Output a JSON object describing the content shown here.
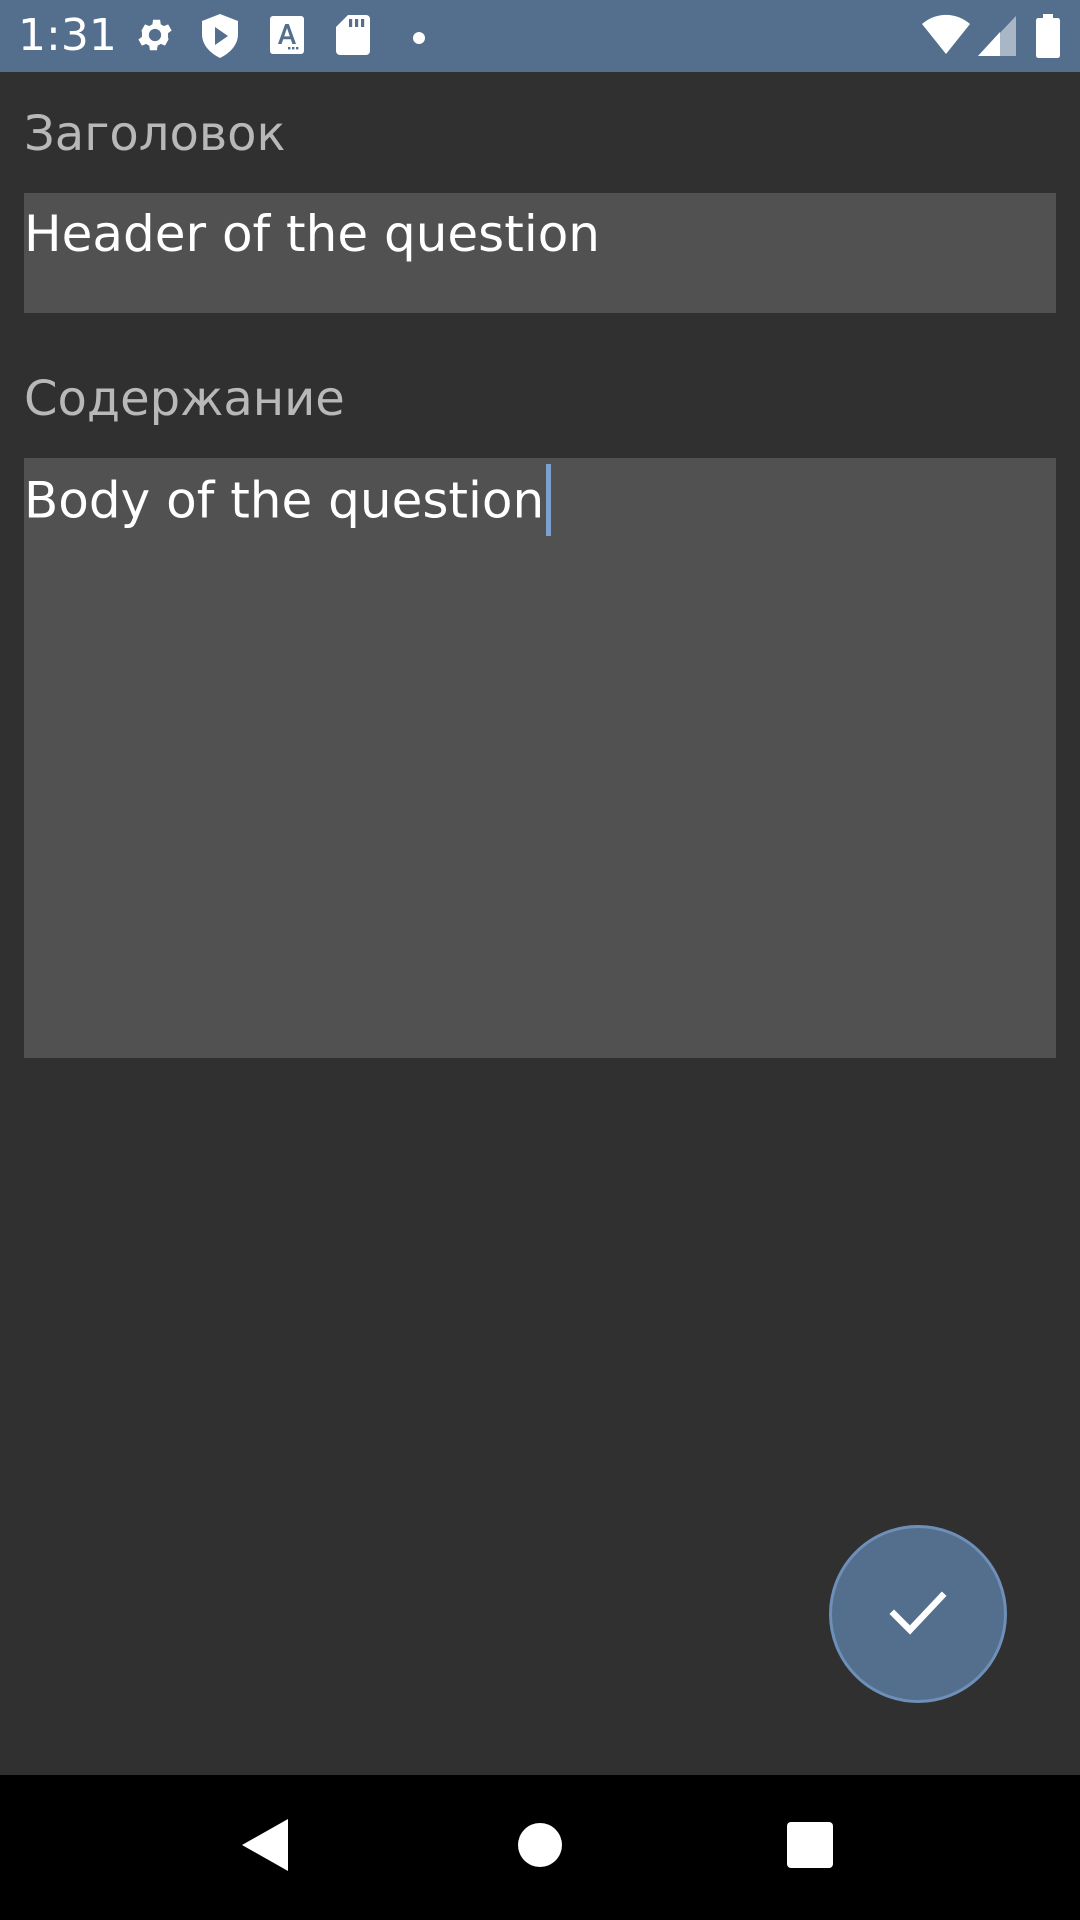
{
  "status_bar": {
    "time": "1:31",
    "icons": [
      "gear-icon",
      "shield-play-icon",
      "text-a-icon",
      "sd-card-icon",
      "notification-dot-icon",
      "wifi-icon",
      "signal-icon",
      "battery-icon"
    ],
    "background": "#536f8d"
  },
  "form": {
    "title_label": "Заголовок",
    "title_value": "Header of the question",
    "body_label": "Содержание",
    "body_value": "Body of the question"
  },
  "fab": {
    "icon": "check-icon",
    "color": "#536f8d"
  },
  "nav_bar": {
    "buttons": [
      "back-icon",
      "home-icon",
      "recents-icon"
    ]
  },
  "colors": {
    "background": "#303030",
    "field_background": "#515151",
    "label_text": "#b8b8b8",
    "cursor": "#7da0cf"
  }
}
